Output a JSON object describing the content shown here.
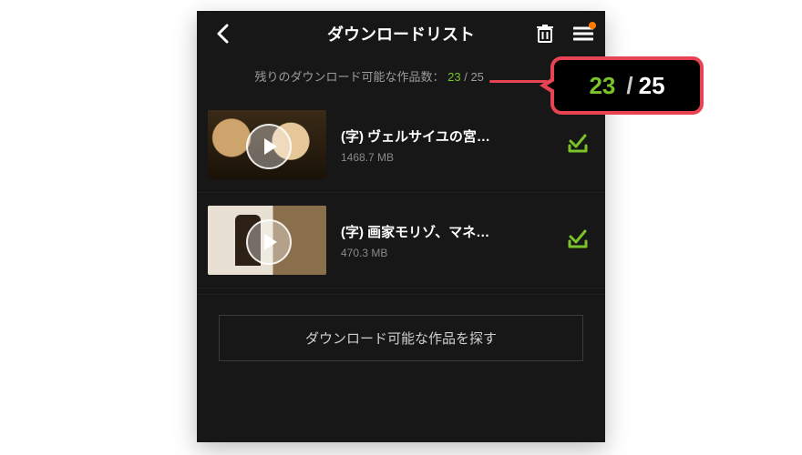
{
  "header": {
    "title": "ダウンロードリスト"
  },
  "remaining": {
    "label_prefix": "残りのダウンロード可能な作品数：",
    "available": "23",
    "separator": "/",
    "total": "25"
  },
  "callout": {
    "available": "23",
    "separator": "/",
    "total": "25"
  },
  "items": [
    {
      "title": "(字) ヴェルサイユの宮…",
      "size": "1468.7 MB"
    },
    {
      "title": "(字) 画家モリゾ、マネ…",
      "size": "470.3 MB"
    }
  ],
  "footer": {
    "find_button": "ダウンロード可能な作品を探す"
  }
}
